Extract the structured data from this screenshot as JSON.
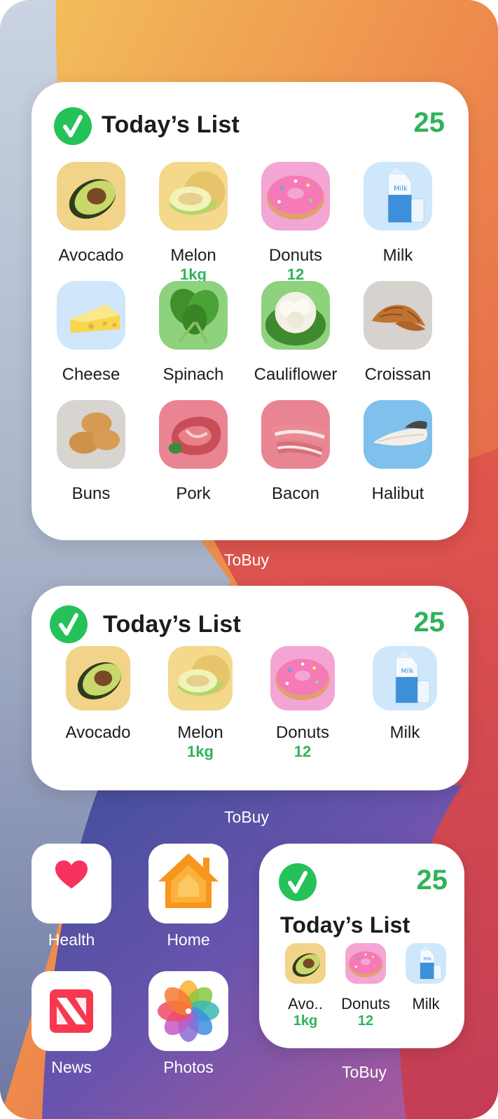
{
  "widget_large": {
    "title": "Today’s List",
    "count": "25",
    "items": [
      {
        "label": "Avocado",
        "qty": "",
        "icon": "avocado-icon",
        "bg": "#f2d38a"
      },
      {
        "label": "Melon",
        "qty": "1kg",
        "icon": "melon-icon",
        "bg": "#f4d98c"
      },
      {
        "label": "Donuts",
        "qty": "12",
        "icon": "donut-icon",
        "bg": "#f3a6d3"
      },
      {
        "label": "Milk",
        "qty": "",
        "icon": "milk-icon",
        "bg": "#cfe7fb"
      },
      {
        "label": "Cheese",
        "qty": "",
        "icon": "cheese-icon",
        "bg": "#cfe6fb"
      },
      {
        "label": "Spinach",
        "qty": "",
        "icon": "spinach-icon",
        "bg": "#8ed27e"
      },
      {
        "label": "Cauliflower",
        "qty": "",
        "icon": "cauliflower-icon",
        "bg": "#8ed27e"
      },
      {
        "label": "Croissan",
        "qty": "",
        "icon": "croissant-icon",
        "bg": "#d6d2cd"
      },
      {
        "label": "Buns",
        "qty": "",
        "icon": "buns-icon",
        "bg": "#d8d4cf"
      },
      {
        "label": "Pork",
        "qty": "",
        "icon": "pork-icon",
        "bg": "#e98592"
      },
      {
        "label": "Bacon",
        "qty": "",
        "icon": "bacon-icon",
        "bg": "#e98592"
      },
      {
        "label": "Halibut",
        "qty": "",
        "icon": "halibut-icon",
        "bg": "#7fc0ec"
      }
    ]
  },
  "widget_medium": {
    "title": "Today’s List",
    "count": "25",
    "items": [
      {
        "label": "Avocado",
        "qty": "",
        "icon": "avocado-icon",
        "bg": "#f2d38a"
      },
      {
        "label": "Melon",
        "qty": "1kg",
        "icon": "melon-icon",
        "bg": "#f4d98c"
      },
      {
        "label": "Donuts",
        "qty": "12",
        "icon": "donut-icon",
        "bg": "#f3a6d3"
      },
      {
        "label": "Milk",
        "qty": "",
        "icon": "milk-icon",
        "bg": "#cfe7fb"
      }
    ]
  },
  "widget_small": {
    "title": "Today’s List",
    "count": "25",
    "items": [
      {
        "label": "Avo..",
        "qty": "1kg",
        "icon": "avocado-icon",
        "bg": "#f2d38a"
      },
      {
        "label": "Donuts",
        "qty": "12",
        "icon": "donut-icon",
        "bg": "#f3a6d3"
      },
      {
        "label": "Milk",
        "qty": "",
        "icon": "milk-icon",
        "bg": "#cfe7fb"
      }
    ]
  },
  "captions": {
    "large": "ToBuy",
    "medium": "ToBuy",
    "small": "ToBuy"
  },
  "apps": [
    {
      "label": "Health",
      "icon": "heart-icon"
    },
    {
      "label": "Home",
      "icon": "house-icon"
    },
    {
      "label": "News",
      "icon": "news-icon"
    },
    {
      "label": "Photos",
      "icon": "photos-flower-icon"
    }
  ],
  "colors": {
    "accent": "#2fb35b",
    "check": "#25c25a"
  }
}
